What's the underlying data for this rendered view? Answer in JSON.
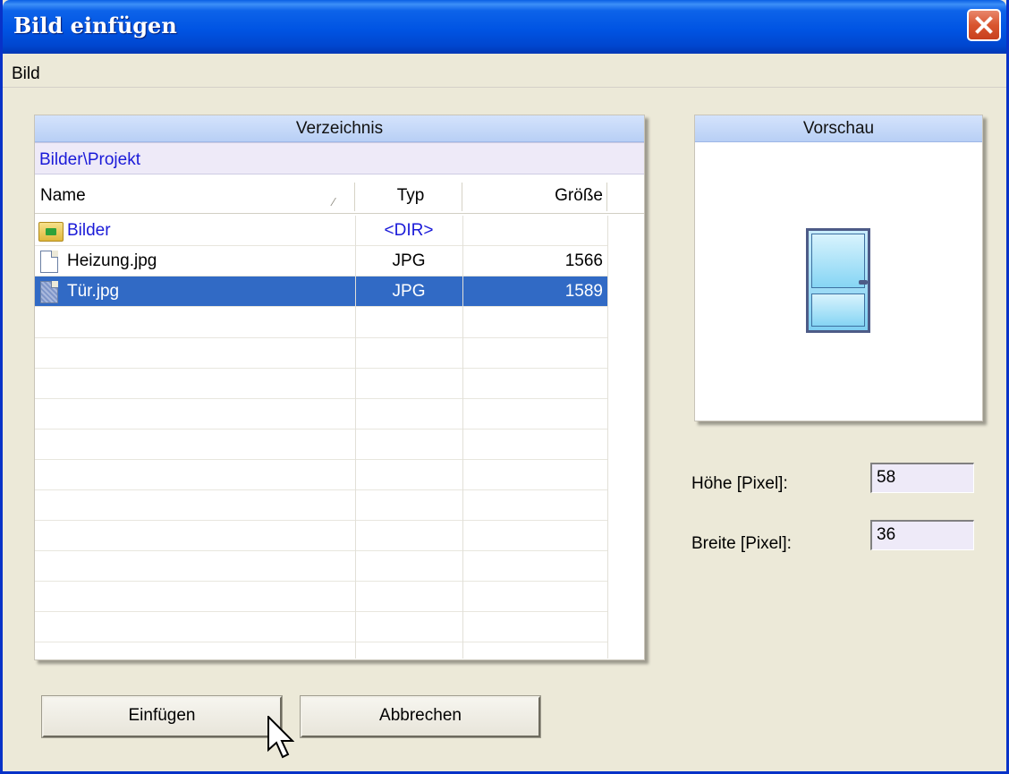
{
  "window": {
    "title": "Bild einfügen"
  },
  "menu": {
    "items": [
      "Bild"
    ]
  },
  "directory": {
    "header": "Verzeichnis",
    "path": "Bilder\\Projekt",
    "columns": {
      "name": "Name",
      "type": "Typ",
      "size": "Größe"
    },
    "rows": [
      {
        "name": "Bilder",
        "type": "<DIR>",
        "size": "",
        "kind": "folder",
        "selected": false
      },
      {
        "name": "Heizung.jpg",
        "type": "JPG",
        "size": "1566",
        "kind": "file",
        "selected": false
      },
      {
        "name": "Tür.jpg",
        "type": "JPG",
        "size": "1589",
        "kind": "file",
        "selected": true
      }
    ]
  },
  "preview": {
    "header": "Vorschau",
    "image_icon": "door-icon"
  },
  "fields": {
    "height_label": "Höhe [Pixel]:",
    "height_value": "58",
    "width_label": "Breite [Pixel]:",
    "width_value": "36"
  },
  "buttons": {
    "insert": "Einfügen",
    "cancel": "Abbrechen"
  },
  "colors": {
    "titlebar": "#0054e3",
    "selection": "#316ac5",
    "dir_link": "#1a1ad8",
    "panel_header": "#c6d9f9"
  }
}
